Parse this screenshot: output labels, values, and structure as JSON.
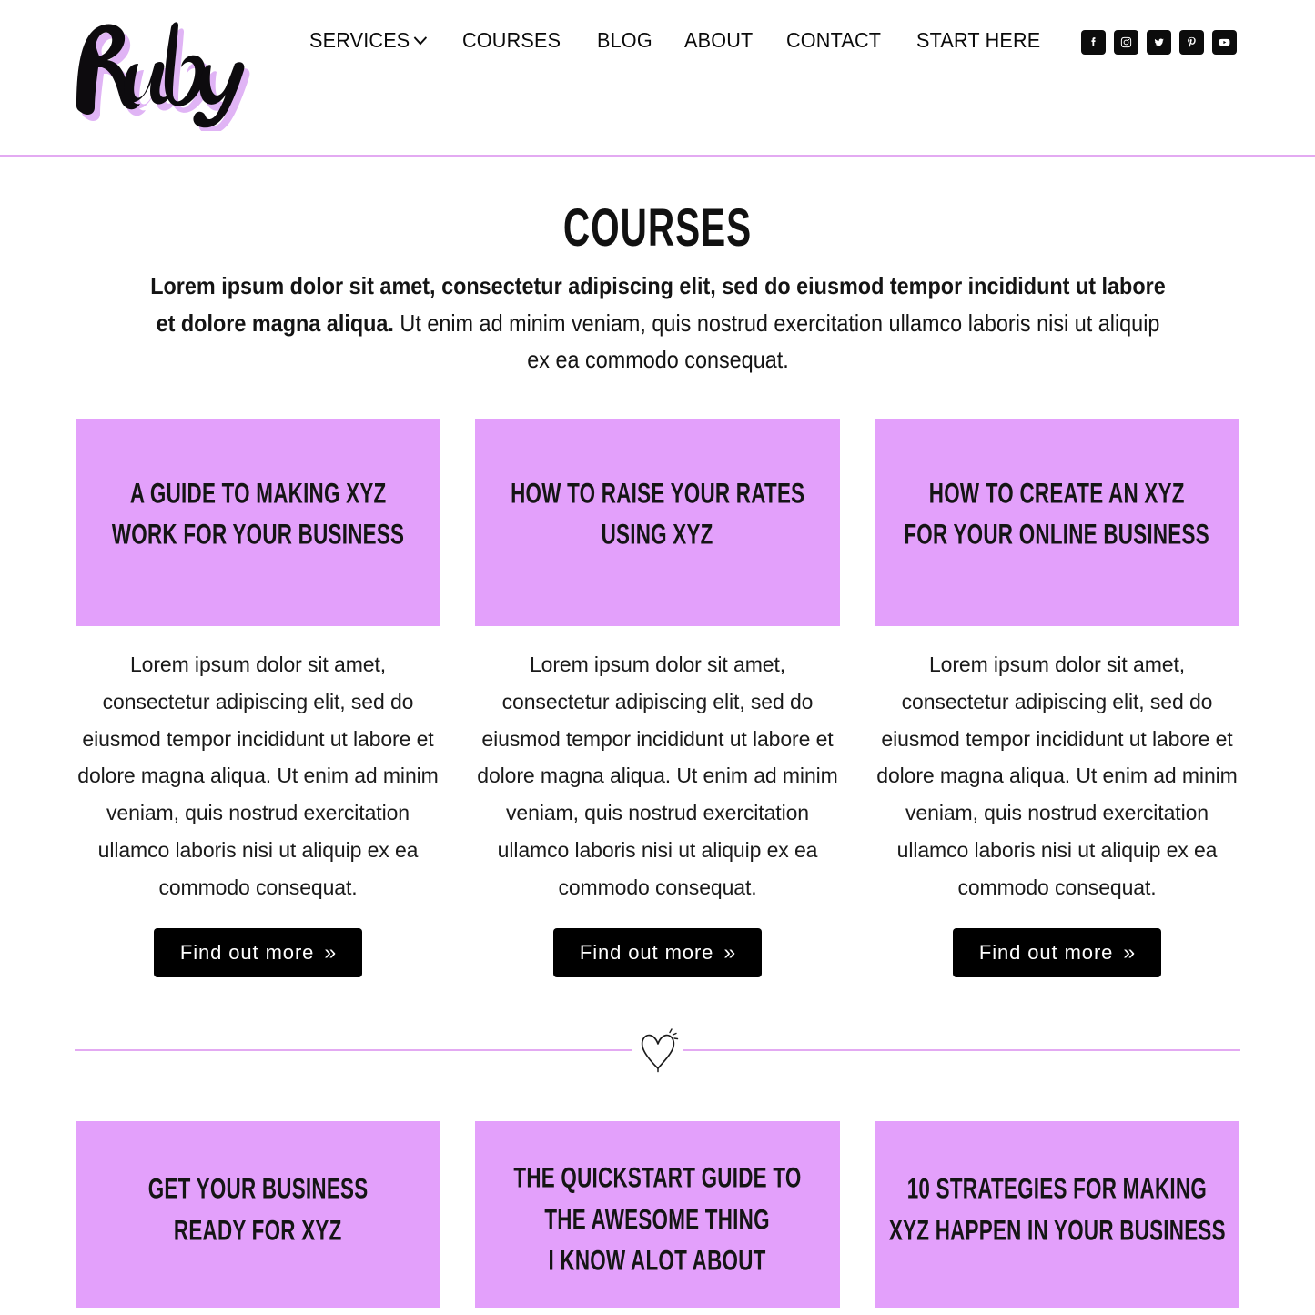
{
  "brand": {
    "logo_text": "Ruby"
  },
  "nav": {
    "items": [
      {
        "label": "SERVICES",
        "has_dropdown": true
      },
      {
        "label": "COURSES",
        "has_dropdown": false
      },
      {
        "label": "BLOG",
        "has_dropdown": false
      },
      {
        "label": "ABOUT",
        "has_dropdown": false
      },
      {
        "label": "CONTACT",
        "has_dropdown": false
      },
      {
        "label": "START HERE",
        "has_dropdown": false
      }
    ]
  },
  "social": {
    "items": [
      {
        "name": "facebook-icon"
      },
      {
        "name": "instagram-icon"
      },
      {
        "name": "twitter-icon"
      },
      {
        "name": "pinterest-icon"
      },
      {
        "name": "youtube-icon"
      }
    ]
  },
  "main": {
    "title": "COURSES",
    "intro_bold": "Lorem ipsum dolor sit amet, consectetur adipiscing elit, sed do eiusmod tempor incididunt ut labore et dolore magna aliqua.",
    "intro_rest": " Ut enim ad minim veniam, quis nostrud exercitation ullamco laboris nisi ut aliquip ex ea commodo consequat."
  },
  "row1": {
    "cards": [
      {
        "title_lines": [
          "A GUIDE TO MAKING XYZ",
          "WORK FOR YOUR BUSINESS"
        ],
        "body": "Lorem ipsum dolor sit amet, consectetur adipiscing elit, sed do eiusmod tempor incididunt ut labore et dolore magna aliqua. Ut enim ad minim veniam, quis nostrud exercitation ullamco laboris nisi ut aliquip ex ea commodo consequat.",
        "cta": "Find out more",
        "cta_arrows": "»"
      },
      {
        "title_lines": [
          "HOW TO RAISE YOUR RATES",
          "USING XYZ"
        ],
        "body": "Lorem ipsum dolor sit amet, consectetur adipiscing elit, sed do eiusmod tempor incididunt ut labore et dolore magna aliqua. Ut enim ad minim veniam, quis nostrud exercitation ullamco laboris nisi ut aliquip ex ea commodo consequat.",
        "cta": "Find out more",
        "cta_arrows": "»"
      },
      {
        "title_lines": [
          "HOW TO CREATE AN XYZ",
          "FOR YOUR ONLINE BUSINESS"
        ],
        "body": "Lorem ipsum dolor sit amet, consectetur adipiscing elit, sed do eiusmod tempor incididunt ut labore et dolore magna aliqua. Ut enim ad minim veniam, quis nostrud exercitation ullamco laboris nisi ut aliquip ex ea commodo consequat.",
        "cta": "Find out more",
        "cta_arrows": "»"
      }
    ]
  },
  "divider": {
    "icon": "heart-sparkle-icon"
  },
  "row2": {
    "cards": [
      {
        "title_lines": [
          "GET YOUR BUSINESS",
          "READY FOR XYZ"
        ]
      },
      {
        "title_lines": [
          "THE QUICKSTART GUIDE TO",
          "THE AWESOME THING",
          "I KNOW ALOT ABOUT"
        ]
      },
      {
        "title_lines": [
          "10 STRATEGIES FOR MAKING",
          "XYZ HAPPEN IN YOUR BUSINESS"
        ]
      }
    ]
  },
  "colors": {
    "card_bg": "#e3a0fb",
    "accent_line": "#e3aaf2",
    "button_bg": "#000000",
    "text": "#111111",
    "page_bg": "#ffffff"
  }
}
